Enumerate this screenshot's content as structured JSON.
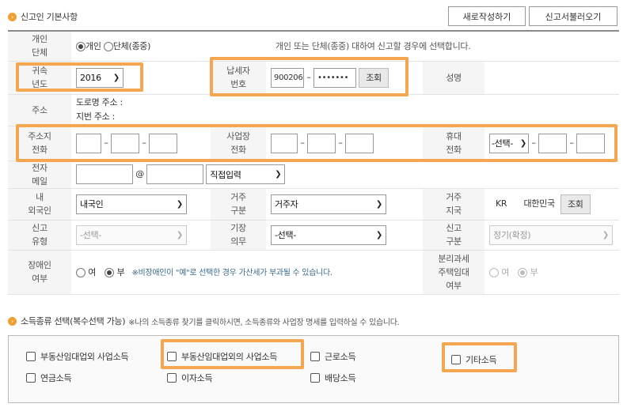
{
  "section1": {
    "title": "신고인 기본사항",
    "buttons": {
      "new_report": "새로작성하기",
      "load_report": "신고서불러오기"
    }
  },
  "form": {
    "applicant_type": {
      "label": "개인\n단체",
      "options": [
        "개인",
        "단체(종중)"
      ],
      "selected": "개인",
      "note": "개인 또는 단체(종중) 대하여 신고할 경우에 선택합니다."
    },
    "year": {
      "label": "귀속\n년도",
      "value": "2016"
    },
    "taxpayer_no": {
      "label": "납세자\n번호",
      "part1": "900206",
      "part2": "•••••••",
      "lookup_btn": "조회"
    },
    "name": {
      "label": "성명",
      "value": ""
    },
    "address": {
      "label": "주소",
      "road_label": "도로명 주소 :",
      "lot_label": "지번 주소 :"
    },
    "home_phone": {
      "label": "주소지\n전화"
    },
    "biz_phone": {
      "label": "사업장\n전화"
    },
    "mobile": {
      "label": "휴대\n전화",
      "carrier": "-선택-"
    },
    "email": {
      "label": "전자\n메일",
      "at": "@",
      "domain_select": "직접입력"
    },
    "nationality": {
      "label": "내\n외국인",
      "value": "내국인"
    },
    "residence": {
      "label": "거주\n구분",
      "value": "거주자"
    },
    "residence_country": {
      "label": "거주\n지국",
      "code": "KR",
      "name": "대한민국",
      "lookup_btn": "조회"
    },
    "filing_type": {
      "label": "신고\n유형",
      "value": "-선택-"
    },
    "bookkeeping": {
      "label": "기장\n의무",
      "value": "-선택-"
    },
    "filing_class": {
      "label": "신고\n구분",
      "value": "정기(확정)"
    },
    "disability": {
      "label": "장애인\n여부",
      "yes": "여",
      "no": "부",
      "selected": "부",
      "note": "※비장애인이 \"예\"로 선택한 경우 가산세가 부과될 수 있습니다."
    },
    "separate_tax": {
      "label": "분리과세\n주택임대\n여부",
      "yes": "여",
      "no": "부",
      "selected": "부"
    }
  },
  "section2": {
    "title": "소득종류 선택(복수선택 가능)",
    "note": "※나의 소득종류 찾기를 클릭하시면, 소득종류와 사업장 명세를 입력하실 수 있습니다.",
    "items": [
      {
        "label": "부동산임대업외 사업소득",
        "checked": false
      },
      {
        "label": "부동산임대업외의 사업소득",
        "checked": false
      },
      {
        "label": "근로소득",
        "checked": false
      },
      {
        "label": "기타소득",
        "checked": false
      },
      {
        "label": "연금소득",
        "checked": false
      },
      {
        "label": "이자소득",
        "checked": false
      },
      {
        "label": "배당소득",
        "checked": false
      }
    ]
  },
  "colors": {
    "highlight": "#f4a750",
    "section_dot": "#f0a030",
    "label_bg": "#f5f5f5"
  }
}
